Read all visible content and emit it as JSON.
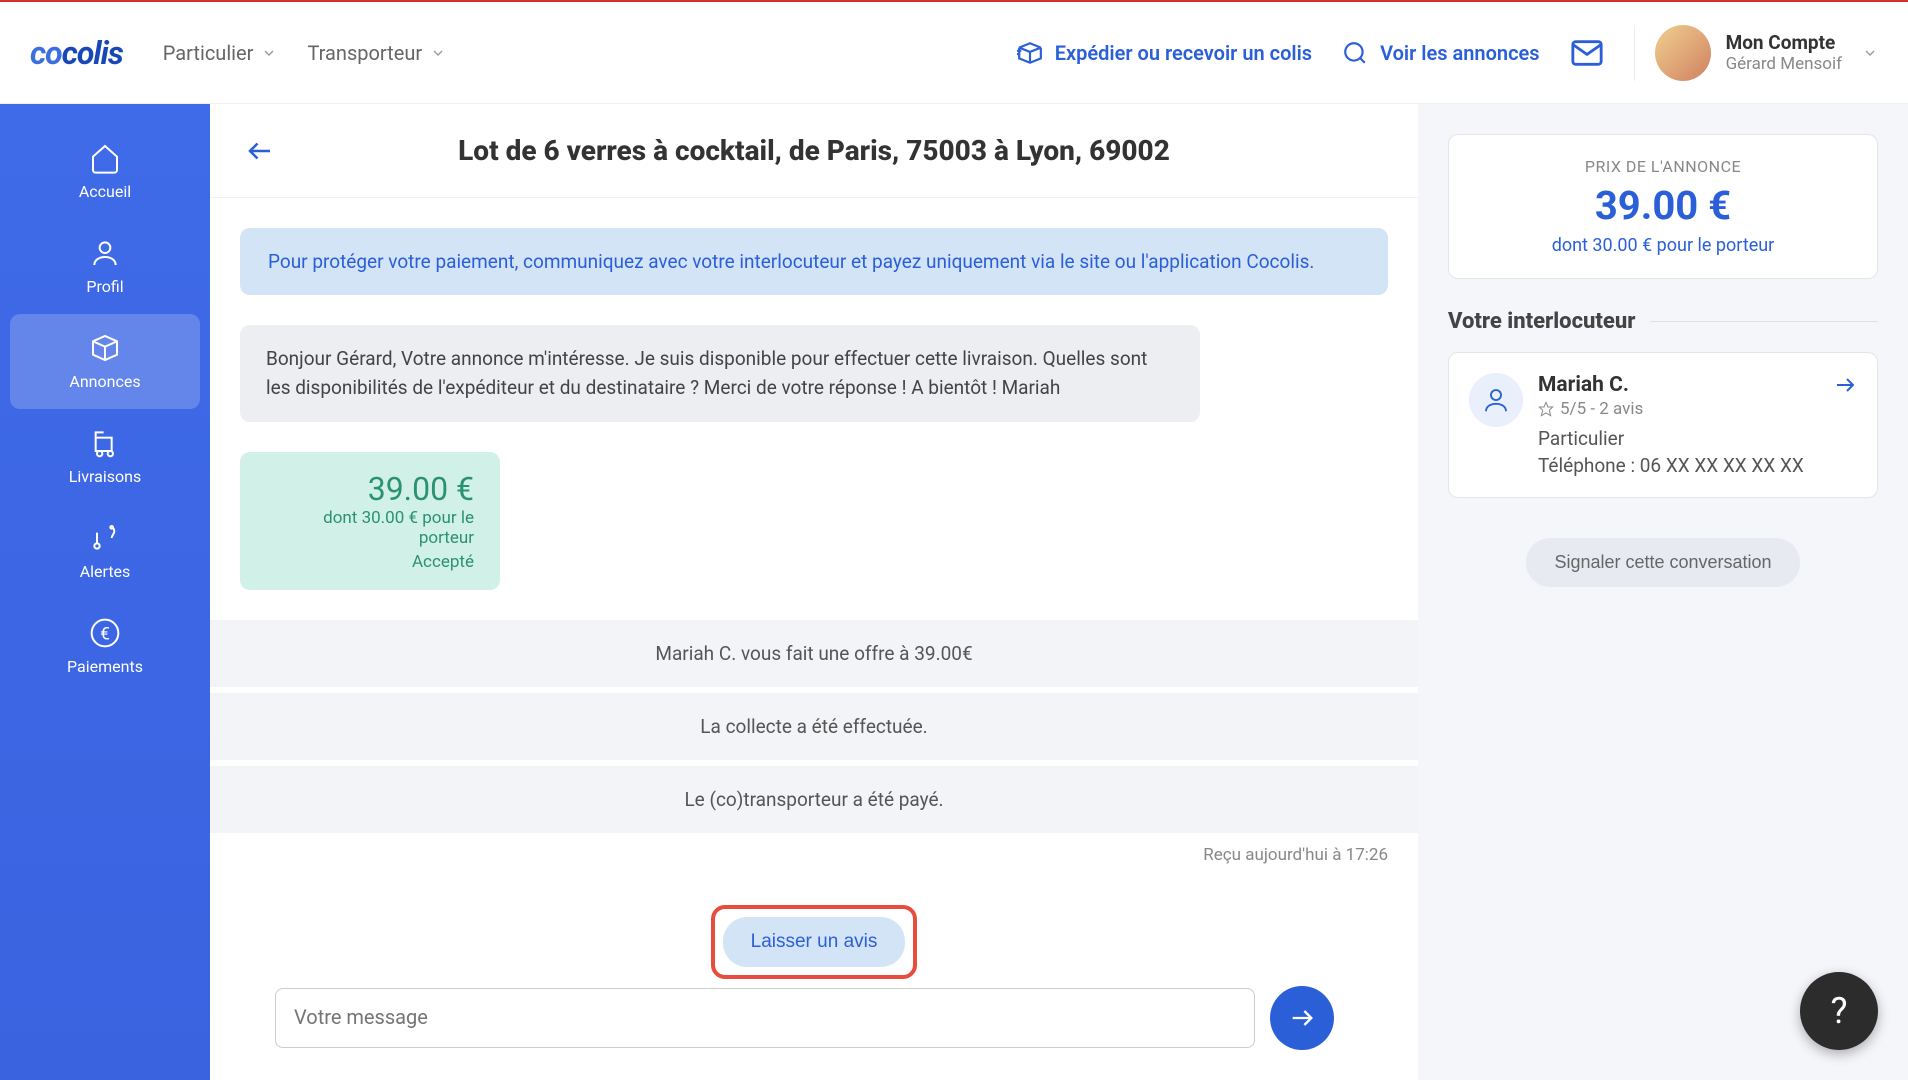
{
  "header": {
    "logo": "cocolis",
    "nav": {
      "particulier": "Particulier",
      "transporteur": "Transporteur"
    },
    "ship": "Expédier ou recevoir un colis",
    "ads": "Voir les annonces",
    "account_label": "Mon Compte",
    "user_name": "Gérard Mensoif"
  },
  "sidebar": {
    "accueil": "Accueil",
    "profil": "Profil",
    "annonces": "Annonces",
    "livraisons": "Livraisons",
    "alertes": "Alertes",
    "paiements": "Paiements"
  },
  "chat": {
    "title": "Lot de 6 verres à cocktail, de Paris, 75003 à Lyon, 69002",
    "warning": "Pour protéger votre paiement, communiquez avec votre interlocuteur et payez uniquement via le site ou l'application Cocolis.",
    "message1": "Bonjour Gérard, Votre annonce m'intéresse. Je suis disponible pour effectuer cette livraison. Quelles sont les disponibilités de l'expéditeur et du destinataire ? Merci de votre réponse ! A bientôt ! Mariah",
    "offer_price": "39.00 €",
    "offer_sub": "dont 30.00 € pour le porteur",
    "offer_status": "Accepté",
    "status1": "Mariah C. vous fait une offre à 39.00€",
    "status2": "La collecte a été effectuée.",
    "status3": "Le (co)transporteur a été payé.",
    "timestamp": "Reçu aujourd'hui à 17:26",
    "review_btn": "Laisser un avis",
    "compose_placeholder": "Votre message"
  },
  "right": {
    "price_label": "PRIX DE L'ANNONCE",
    "price": "39.00 €",
    "price_sub": "dont 30.00 € pour le porteur",
    "section": "Votre interlocuteur",
    "name": "Mariah C.",
    "rating": "5/5 - 2 avis",
    "type": "Particulier",
    "phone": "Téléphone : 06 XX XX XX XX XX",
    "report": "Signaler cette conversation"
  },
  "help": "?"
}
